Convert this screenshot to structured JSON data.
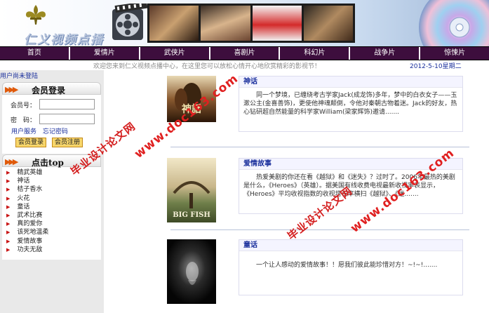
{
  "banner": {
    "logo_text": "仁义视频点播"
  },
  "nav": {
    "items": [
      "首页",
      "爱情片",
      "武侠片",
      "喜剧片",
      "科幻片",
      "战争片",
      "惊悚片"
    ]
  },
  "welcome": {
    "message": "欢迎您来到仁义视频点播中心，在这里您可以放松心情开心地欣赏精彩的影视节！",
    "date": "2012-5-10星期二"
  },
  "sidebar": {
    "user_status": "用户尚未登陆",
    "login": {
      "title": "会员登录",
      "username_label": "会员号：",
      "password_label": "密　码：",
      "username_value": "",
      "password_value": "",
      "link_service": "用户服务",
      "link_forgot": "忘记密码",
      "login_button": "会员登录",
      "register_button": "会员注册"
    },
    "top": {
      "title": "点击top",
      "items": [
        "精武英雄",
        "神话",
        "桔子香水",
        "火花",
        "童话",
        "武术比赛",
        "真的爱你",
        "该死地温柔",
        "爱情故事",
        "功夫无敌"
      ]
    }
  },
  "movies": [
    {
      "title": "神话",
      "description": "同一个梦境，已缠绕考古学家Jack(成龙饰)多年，梦中的白衣女子——玉漱公主(金喜善饰)，更使他神魂颠倒，令他对秦朝古物着迷。Jack的好友，热心钻研超自然能量的科学家William(梁家辉饰)邀请.......",
      "poster_text": "神話"
    },
    {
      "title": "爱情故事",
      "description": "热爱美剧的你还在看《越狱》和《迷失》？过时了。2006年最热的美剧是什么，《Heroes》（英雄）。据美国有线收费电视最新收视率表显示，《Heroes》平均收视指数的收视增长率横扫《越狱》、《迷.......",
      "poster_text": "BIG FISH"
    },
    {
      "title": "童话",
      "description": "一个让人感动的爱情故事！！愿我们彼此能珍惜对方！~!~!.......",
      "poster_text": ""
    }
  ],
  "watermarks": {
    "site": "www.doc163.com",
    "cn": "毕业设计论文网"
  },
  "colors": {
    "nav_bg": "#3d0e3d",
    "link_blue": "#1a2f9c",
    "accent_orange": "#e05a0a",
    "watermark_red": "#e02020",
    "button_yellow": "#f7d66b"
  }
}
